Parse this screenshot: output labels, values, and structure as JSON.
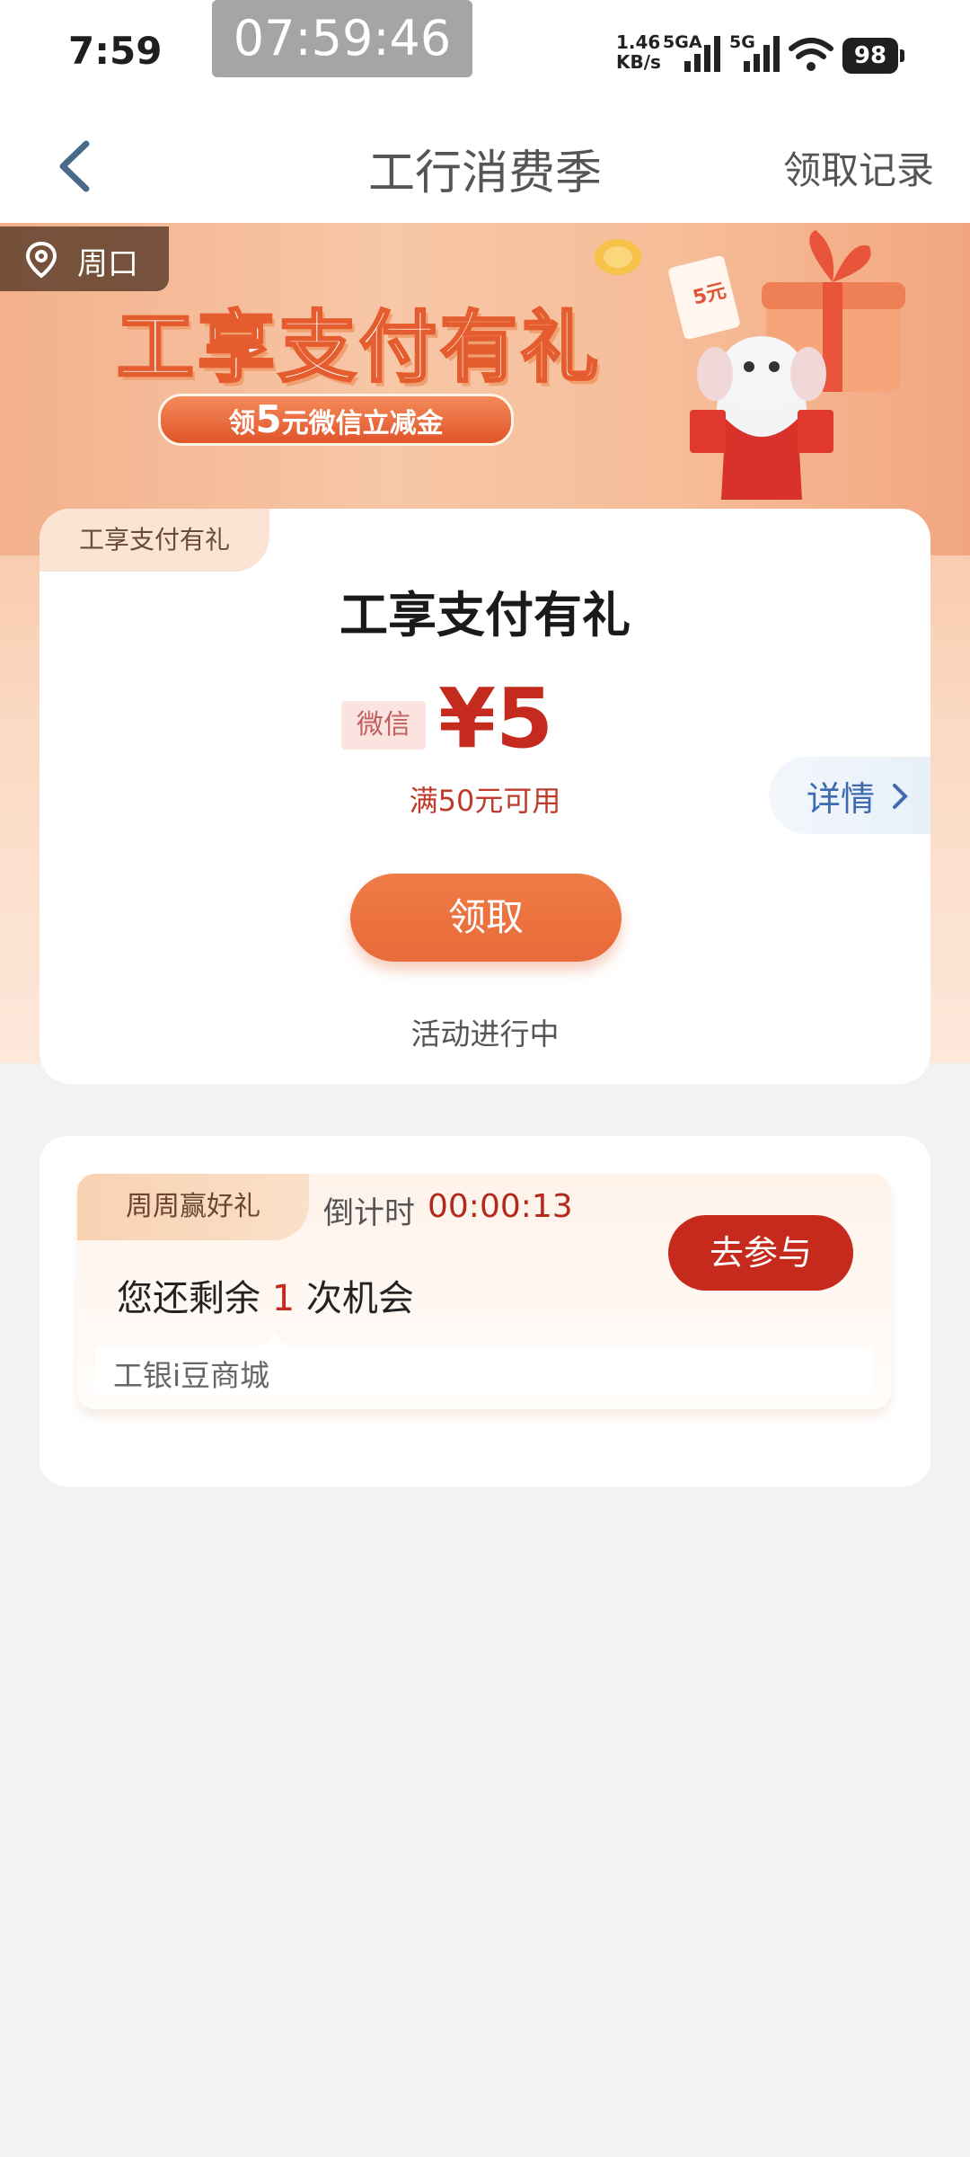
{
  "status_bar": {
    "time": "7:59",
    "recording_clock": "07:59:46",
    "net_speed_value": "1.46",
    "net_speed_unit": "KB/s",
    "sig1_label": "5GA",
    "sig2_label": "5G",
    "battery": "98"
  },
  "nav": {
    "title": "工行消费季",
    "record_link": "领取记录"
  },
  "banner": {
    "location": "周口",
    "headline": "工享支付有礼",
    "pill_prefix": "领",
    "pill_amount": "5",
    "pill_suffix": "元微信立减金",
    "coupon_ticket_text": "5元"
  },
  "coupon_card": {
    "tag": "工享支付有礼",
    "title": "工享支付有礼",
    "channel": "微信",
    "amount": "¥5",
    "condition": "满50元可用",
    "detail_label": "详情",
    "claim_button": "领取",
    "status_text": "活动进行中"
  },
  "weekly_card": {
    "tab": "周周赢好礼",
    "countdown_label": "倒计时",
    "countdown_value": "00:00:13",
    "remaining_prefix": "您还剩余",
    "remaining_count": "1",
    "remaining_suffix": "次机会",
    "join_button": "去参与",
    "shop_name": "工银i豆商城"
  },
  "colors": {
    "accent_red": "#c62a1d",
    "claim_orange": "#ec7541",
    "banner_peach": "#f7c7a7"
  }
}
